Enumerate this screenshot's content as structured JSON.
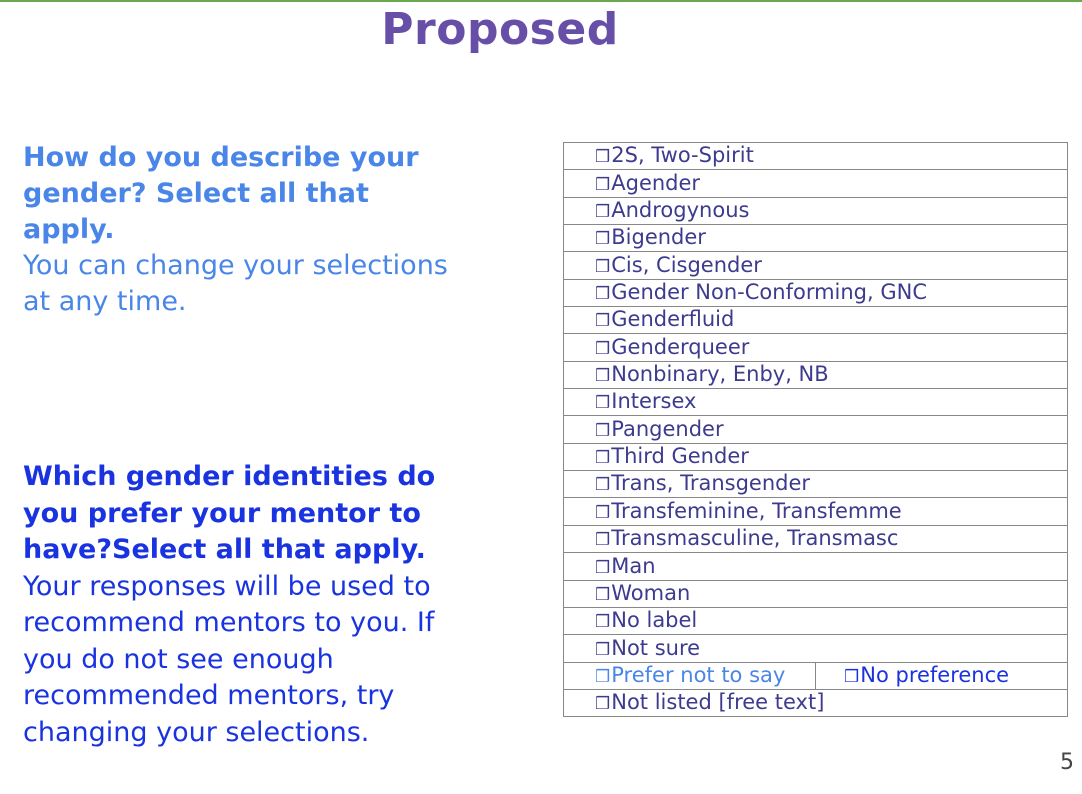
{
  "slide": {
    "title": "Proposed",
    "page_number": "5"
  },
  "question_self": {
    "prompt": "How do you describe your gender? Select all that apply.",
    "note": "You can change your selections at any time."
  },
  "question_mentor": {
    "prompt": "Which gender identities do you prefer your mentor to have?Select all that apply.",
    "note": "Your responses will be used to recommend mentors to you. If you do not see enough recommended mentors, try changing your selections."
  },
  "checkbox_glyph": "❒",
  "options": [
    "2S, Two-Spirit",
    "Agender",
    "Androgynous",
    "Bigender",
    "Cis, Cisgender",
    "Gender Non-Conforming, GNC",
    "Genderfluid",
    "Genderqueer",
    "Nonbinary, Enby, NB",
    "Intersex",
    "Pangender",
    "Third Gender",
    "Trans, Transgender",
    "Transfeminine, Transfemme",
    "Transmasculine, Transmasc",
    "Man",
    "Woman",
    "No label",
    "Not sure"
  ],
  "split_row": {
    "left": "Prefer not to say",
    "right": "No preference"
  },
  "last_option": "Not listed [free text]",
  "colors": {
    "title": "#674ea7",
    "question_self": "#4a86e8",
    "question_mentor": "#1a33e0",
    "option_text": "#3d3b8e",
    "top_rule": "#6aa84f"
  }
}
